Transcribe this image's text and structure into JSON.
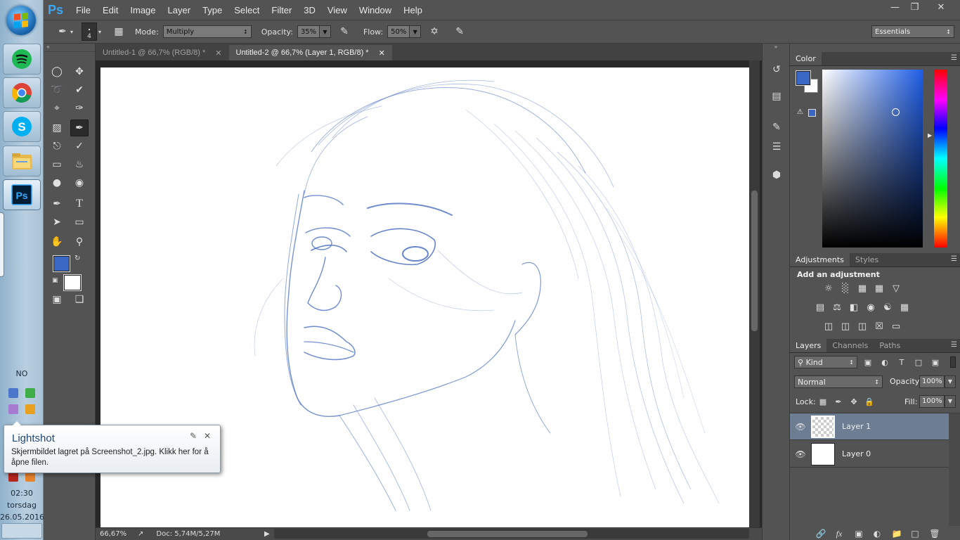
{
  "taskbar": {
    "apps": [
      {
        "name": "Spotify",
        "icon": "spotify-icon"
      },
      {
        "name": "Chrome",
        "icon": "chrome-icon"
      },
      {
        "name": "Skype",
        "icon": "skype-icon"
      },
      {
        "name": "File Explorer",
        "icon": "folder-icon"
      },
      {
        "name": "Photoshop",
        "icon": "photoshop-icon"
      }
    ],
    "language": "NO",
    "clock_time": "02:30",
    "clock_day": "torsdag",
    "clock_date": "26.05.2016"
  },
  "menubar": {
    "logo": "Ps",
    "items": [
      "File",
      "Edit",
      "Image",
      "Layer",
      "Type",
      "Select",
      "Filter",
      "3D",
      "View",
      "Window",
      "Help"
    ]
  },
  "options": {
    "brush_size": "4",
    "mode_label": "Mode:",
    "mode_value": "Multiply",
    "opacity_label": "Opacity:",
    "opacity_value": "35%",
    "flow_label": "Flow:",
    "flow_value": "50%",
    "workspace": "Essentials"
  },
  "tabs": [
    {
      "label": "Untitled-1 @ 66,7% (RGB/8) *",
      "active": false
    },
    {
      "label": "Untitled-2 @ 66,7% (Layer 1, RGB/8) *",
      "active": true
    }
  ],
  "status": {
    "zoom": "66,67%",
    "doc": "Doc: 5,74M/5,27M"
  },
  "colors": {
    "foreground": "#3a66c4",
    "background": "#ffffff",
    "sketch": "#4a6fc2"
  },
  "color_panel": {
    "tab": "Color"
  },
  "adjustments": {
    "tabs": [
      "Adjustments",
      "Styles"
    ],
    "heading": "Add an adjustment"
  },
  "layers_panel": {
    "tabs": [
      "Layers",
      "Channels",
      "Paths"
    ],
    "filter_kind": "Kind",
    "blend_mode": "Normal",
    "opacity_label": "Opacity:",
    "opacity_value": "100%",
    "lock_label": "Lock:",
    "fill_label": "Fill:",
    "fill_value": "100%",
    "layers": [
      {
        "name": "Layer 1",
        "selected": true
      },
      {
        "name": "Layer 0",
        "selected": false
      }
    ]
  },
  "notification": {
    "title": "Lightshot",
    "body": "Skjermbildet lagret på Screenshot_2.jpg. Klikk her for å åpne filen."
  }
}
